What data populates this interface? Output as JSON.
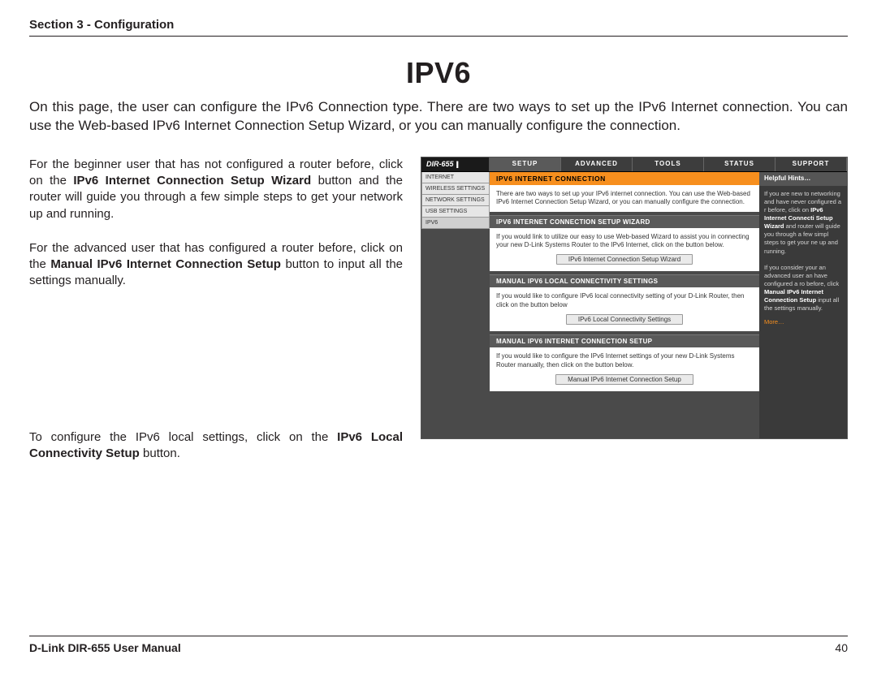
{
  "section_header": "Section 3 - Configuration",
  "page_title": "IPV6",
  "intro": "On this page, the user can configure the IPv6 Connection type. There are two ways to set up the IPv6 Internet connection. You can use the Web-based IPv6 Internet Connection Setup Wizard, or you can manually configure the connection.",
  "para1_a": "For the beginner user that has not configured a router before, click on the ",
  "para1_b_bold": "IPv6 Internet Connection Setup Wizard",
  "para1_c": " button and the router will guide you through a few simple steps to get your network up and running.",
  "para2_a": "For the advanced user that has configured a router before, click on the ",
  "para2_b_bold": "Manual IPv6 Internet Connection Setup",
  "para2_c": " button to input all the settings manually.",
  "para3_a": "To configure the IPv6 local settings, click on the ",
  "para3_b_bold": "IPv6 Local Connectivity Setup",
  "para3_c": " button.",
  "router": {
    "model": "DIR-655",
    "tabs": [
      "SETUP",
      "ADVANCED",
      "TOOLS",
      "STATUS",
      "SUPPORT"
    ],
    "sidebar": [
      "INTERNET",
      "WIRELESS SETTINGS",
      "NETWORK SETTINGS",
      "USB SETTINGS",
      "IPV6"
    ],
    "orange_header": "IPV6 INTERNET CONNECTION",
    "orange_text": "There are two ways to set up your IPv6 internet connection. You can use the Web-based IPv6 Internet Connection Setup Wizard, or you can manually configure the connection.",
    "sec1_header": "IPV6 INTERNET CONNECTION SETUP WIZARD",
    "sec1_text": "If you would link to utilize our easy to use Web-based Wizard to assist you in connecting your new D-Link Systems Router to the IPv6 Internet, click on the button below.",
    "sec1_button": "IPv6 Internet Connection Setup Wizard",
    "sec2_header": "MANUAL IPV6 LOCAL CONNECTIVITY SETTINGS",
    "sec2_text": "If you would like to configure IPv6 local connectivity setting of your D-Link Router, then click on the button below",
    "sec2_button": "IPv6 Local Connectivity Settings",
    "sec3_header": "MANUAL IPV6 INTERNET CONNECTION SETUP",
    "sec3_text": "If you would like to configure the IPv6 Internet settings of your new D-Link Systems Router manually, then click on the button below.",
    "sec3_button": "Manual IPv6 Internet Connection Setup",
    "hints_header": "Helpful Hints…",
    "hints_p1_a": "If you are new to networking and have never configured a r",
    "hints_p1_b": "before, click on ",
    "hints_p1_bold1": "IPv6",
    "hints_p1_bold2": "Internet Connecti",
    "hints_p1_bold3": "Setup Wizard",
    "hints_p1_c": " and router will guide you through a few simpl steps to get your ne up and running.",
    "hints_p2_a": "If you consider your an advanced user an have configured a ro before, click ",
    "hints_p2_bold1": "Manual",
    "hints_p2_bold2": "IPv6 Internet Connection Setup",
    "hints_p2_b": " input all the settings manually.",
    "more": "More…"
  },
  "footer": {
    "manual": "D-Link DIR-655 User Manual",
    "page": "40"
  }
}
